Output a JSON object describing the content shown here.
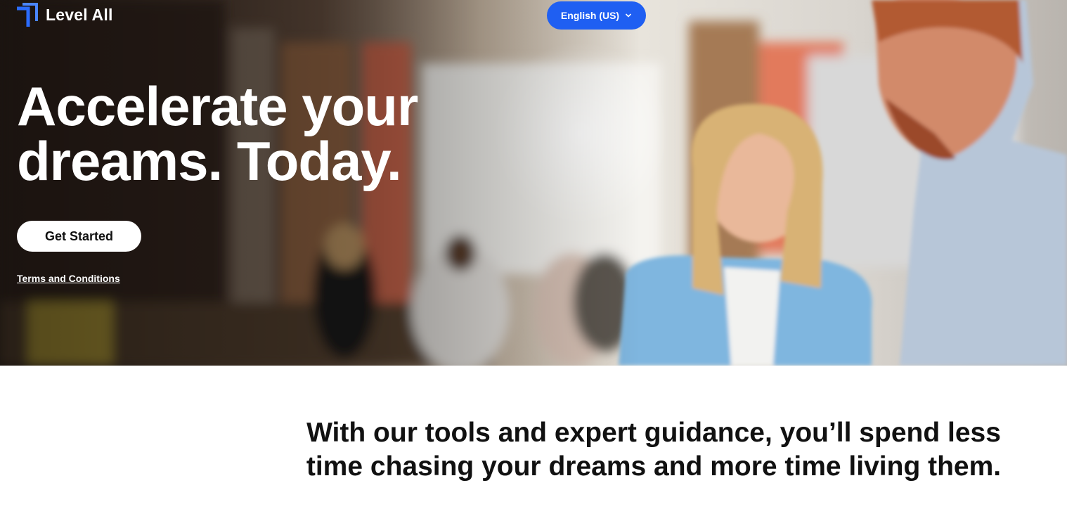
{
  "brand": {
    "name": "Level All",
    "accent_color": "#1f5ff2",
    "logo_icon": "level-all-logo-icon"
  },
  "language_selector": {
    "label": "English (US)",
    "icon": "chevron-down-icon"
  },
  "hero": {
    "headline_line1": "Accelerate your",
    "headline_line2": "dreams. Today.",
    "cta_label": "Get Started",
    "terms_link": "Terms and Conditions"
  },
  "intro": {
    "line1": "With our tools and expert guidance, you’ll spend less",
    "line2": "time chasing your dreams and more time living them."
  }
}
